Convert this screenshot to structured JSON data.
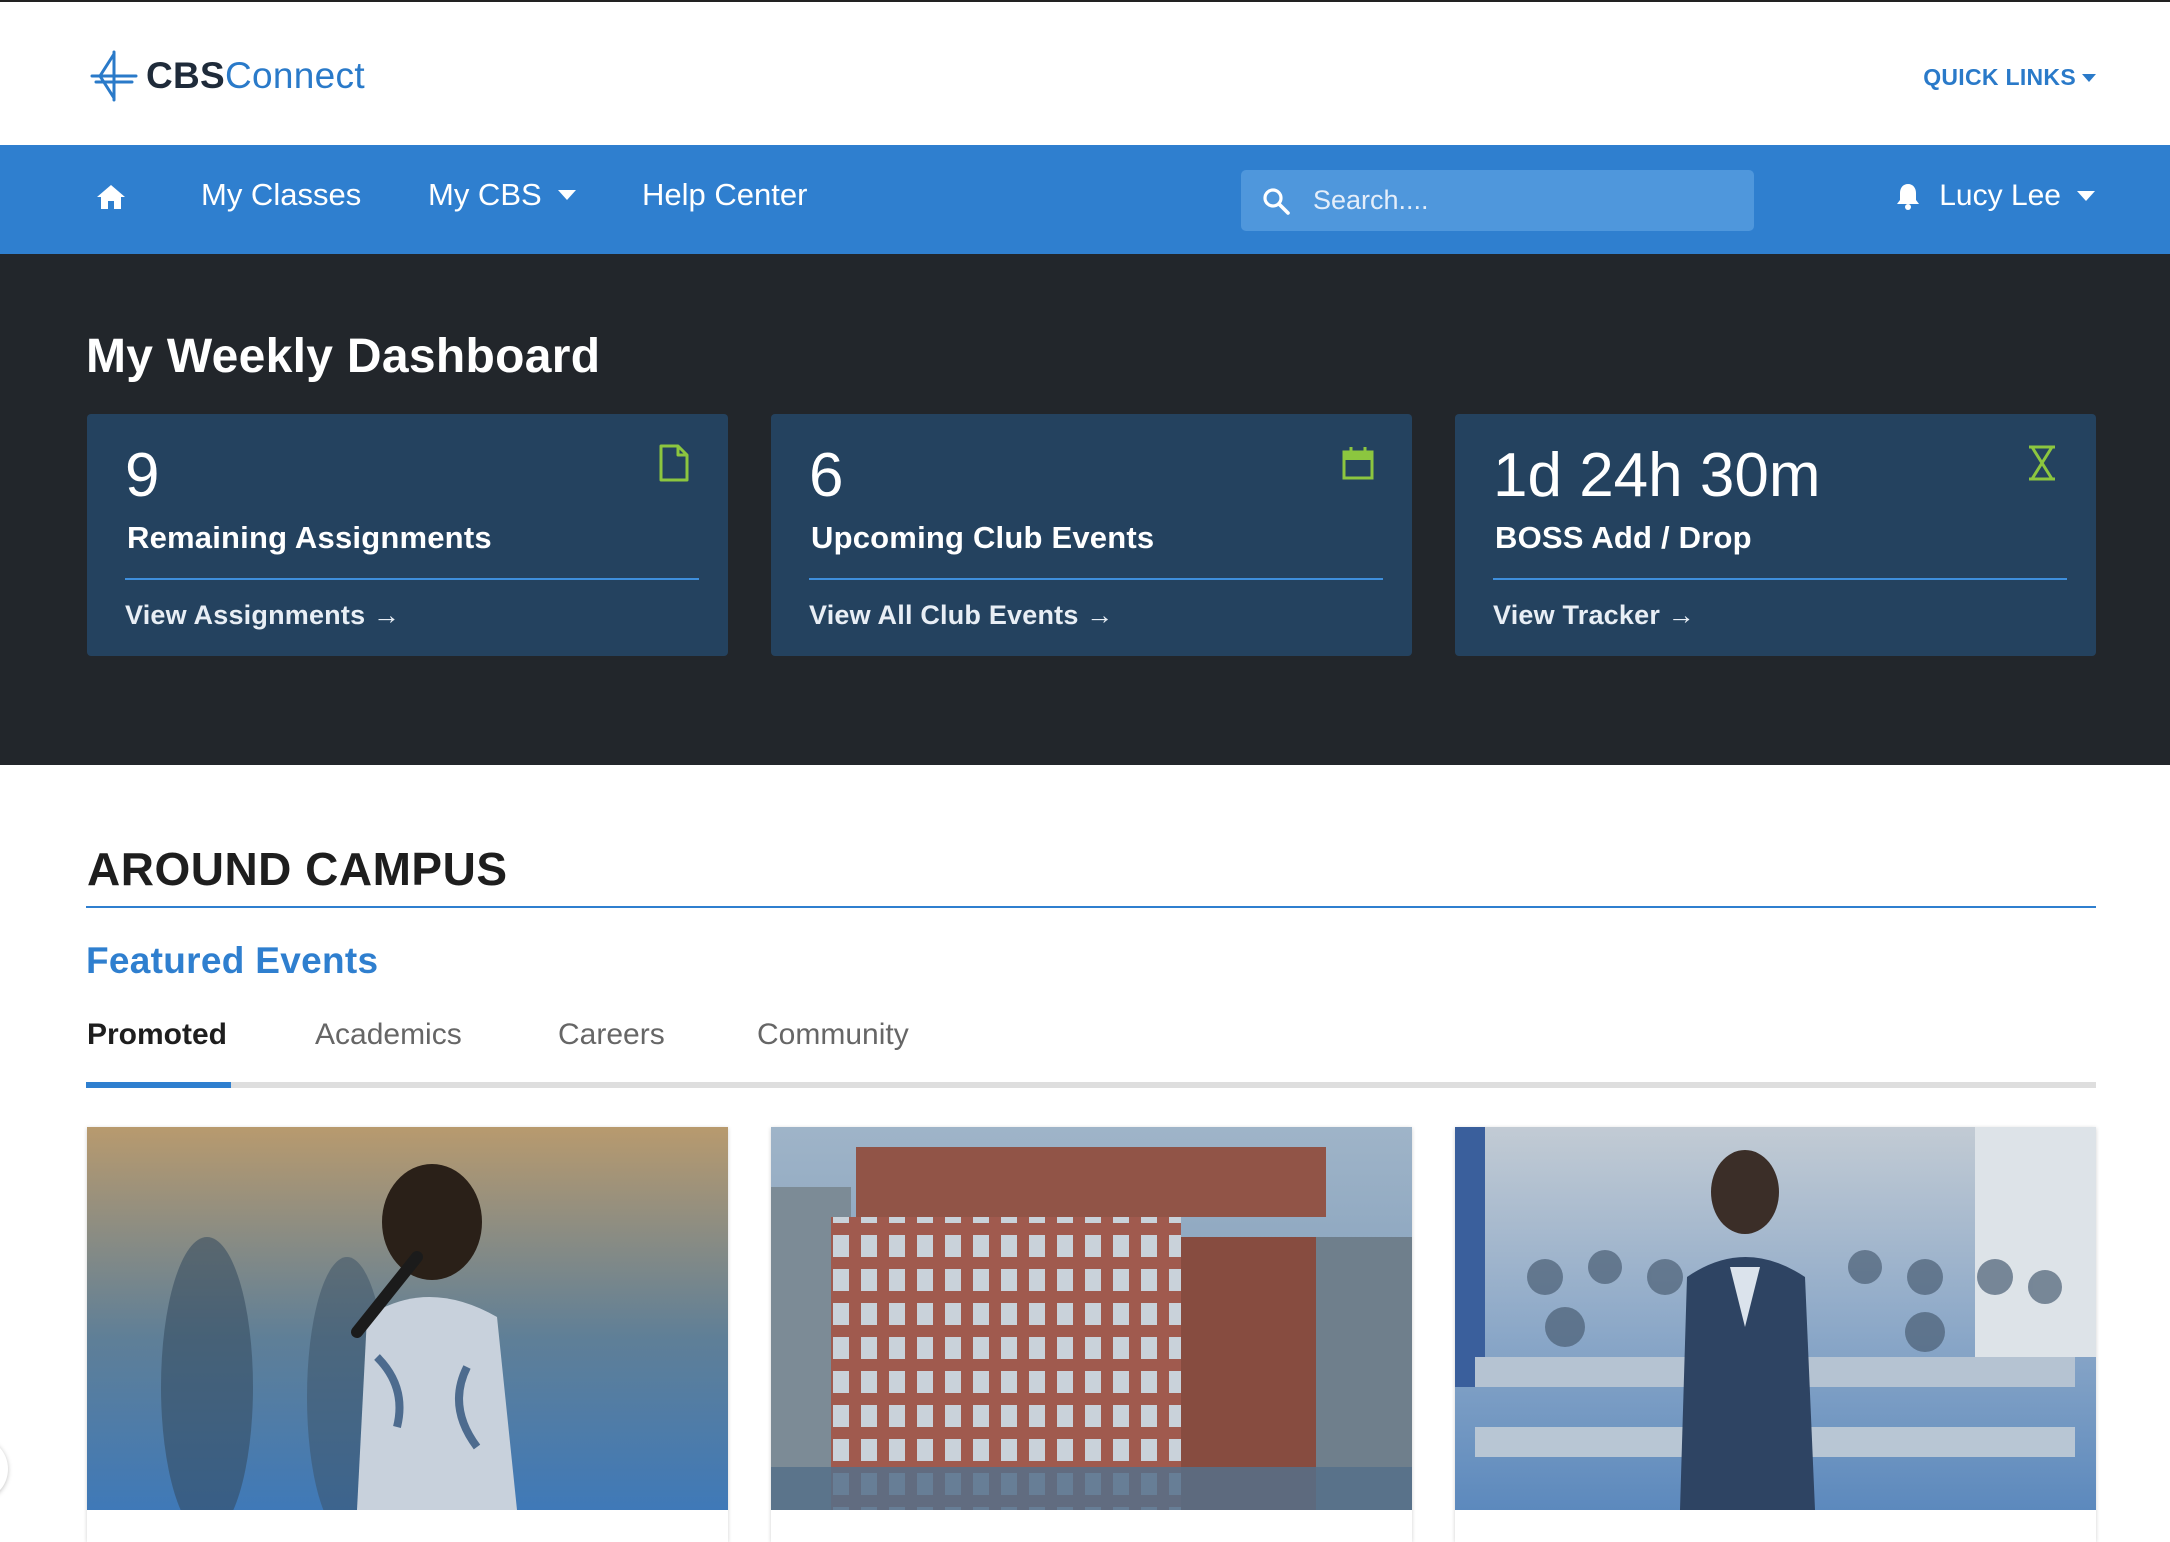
{
  "header": {
    "logo": {
      "bold": "CBS",
      "light": "Connect"
    },
    "quick_links": "QUICK LINKS",
    "icons": {
      "logo": "cbs-logo-mark",
      "dropdown": "caret-down-icon"
    },
    "colors": {
      "brand_blue": "#2a7ac9",
      "logo_dark": "#1f2b3a"
    }
  },
  "nav": {
    "home_icon": "home-icon",
    "items": [
      {
        "label": "My Classes"
      },
      {
        "label": "My CBS",
        "has_dropdown": true
      },
      {
        "label": "Help Center"
      }
    ],
    "search": {
      "placeholder": "Search...."
    },
    "user": {
      "name": "Lucy Lee",
      "icon": "bell-icon"
    },
    "colors": {
      "bar": "#2f7fcf",
      "search_bg": "#4f97dc"
    }
  },
  "dashboard": {
    "title": "My Weekly Dashboard",
    "cards": [
      {
        "value": "9",
        "label": "Remaining Assignments",
        "link": "View Assignments →",
        "icon": "document-icon"
      },
      {
        "value": "6",
        "label": "Upcoming Club Events",
        "link": "View All Club Events →",
        "icon": "calendar-icon"
      },
      {
        "value": "1d 24h 30m",
        "label": "BOSS Add / Drop",
        "link": "View Tracker →",
        "icon": "hourglass-icon"
      }
    ],
    "colors": {
      "background": "#22262b",
      "card": "#24425f",
      "icon_accent": "#8cc63f"
    }
  },
  "campus": {
    "title": "AROUND CAMPUS",
    "subtitle": "Featured Events",
    "tabs": [
      {
        "label": "Promoted",
        "active": true
      },
      {
        "label": "Academics"
      },
      {
        "label": "Careers"
      },
      {
        "label": "Community"
      }
    ],
    "events": [
      {
        "image": "speaker-with-microphone-photo"
      },
      {
        "image": "campus-building-photo"
      },
      {
        "image": "lecture-hall-photo"
      }
    ]
  }
}
